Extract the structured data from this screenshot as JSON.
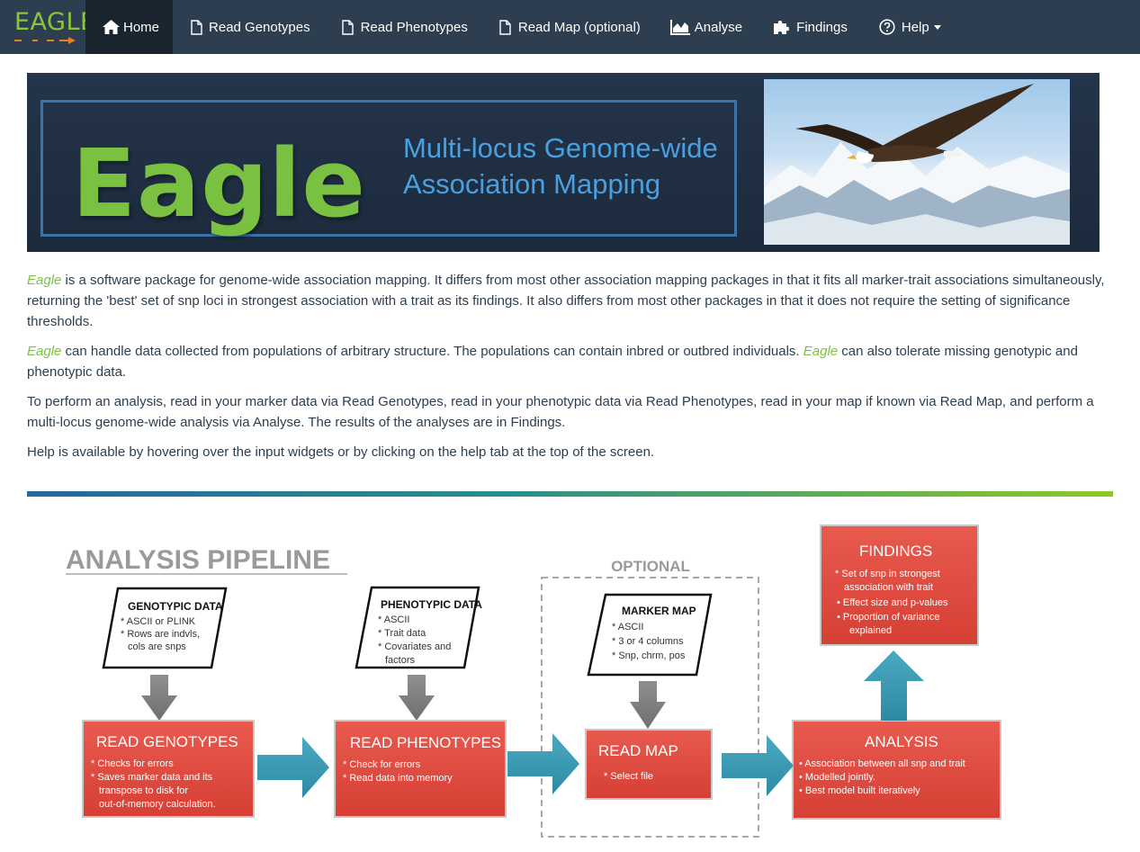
{
  "brand": {
    "name": "EAGLE"
  },
  "nav": {
    "items": [
      {
        "label": "Home",
        "icon": "home-icon",
        "active": true
      },
      {
        "label": "Read Genotypes",
        "icon": "file-icon"
      },
      {
        "label": "Read Phenotypes",
        "icon": "file-icon"
      },
      {
        "label": "Read Map (optional)",
        "icon": "file-icon"
      },
      {
        "label": "Analyse",
        "icon": "area-chart-icon"
      },
      {
        "label": "Findings",
        "icon": "puzzle-icon"
      },
      {
        "label": "Help",
        "icon": "question-circle-icon",
        "dropdown": true
      }
    ]
  },
  "banner": {
    "title": "Eagle",
    "subtitle_line1": "Multi-locus Genome-wide",
    "subtitle_line2": "Association Mapping"
  },
  "intro": {
    "eagle_word": "Eagle",
    "p1_rest": " is a software package for genome-wide association mapping. It differs from most other association mapping packages in that it fits all marker-trait associations simultaneously, returning the 'best' set of snp loci in strongest association with a trait as its findings. It also differs from most other packages in that it does not require the setting of significance thresholds.",
    "p2_part1": " can handle data collected from populations of arbitrary structure. The populations can contain inbred or outbred individuals. ",
    "p2_part2": " can also tolerate missing genotypic and phenotypic data.",
    "p3": "To perform an analysis, read in your marker data via Read Genotypes, read in your phenotypic data via Read Phenotypes, read in your map if known via Read Map, and perform a multi-locus genome-wide analysis via Analyse. The results of the analyses are in Findings.",
    "p4": "Help is available by hovering over the input widgets or by clicking on the help tab at the top of the screen."
  },
  "pipeline": {
    "heading": "ANALYSIS PIPELINE",
    "optional_label": "OPTIONAL",
    "inputs": [
      {
        "title": "GENOTYPIC DATA",
        "lines": [
          "* ASCII or PLINK",
          "* Rows are indvls,",
          "cols are snps"
        ]
      },
      {
        "title": "PHENOTYPIC DATA",
        "lines": [
          "* ASCII",
          "* Trait data",
          "* Covariates and",
          "factors"
        ]
      },
      {
        "title": "MARKER MAP",
        "lines": [
          "* ASCII",
          "* 3 or 4 columns",
          "* Snp, chrm, pos"
        ]
      }
    ],
    "steps": [
      {
        "title": "READ GENOTYPES",
        "lines": [
          "* Checks for errors",
          "* Saves marker data and its",
          "transpose to disk  for",
          "out-of-memory calculation."
        ]
      },
      {
        "title": "READ PHENOTYPES",
        "lines": [
          "* Check for errors",
          "* Read data into memory"
        ]
      },
      {
        "title": "READ MAP",
        "lines": [
          "* Select file"
        ]
      },
      {
        "title": "ANALYSIS",
        "lines": [
          "•  Association between all snp and trait",
          "•  Modelled jointly.",
          "•  Best model built iteratively"
        ]
      }
    ],
    "findings": {
      "title": "FINDINGS",
      "lines": [
        "* Set of snp in strongest",
        "association with trait",
        "•  Effect size and p-values",
        "•  Proportion of variance",
        "explained"
      ]
    }
  },
  "colors": {
    "navbar": "#2c3e50",
    "navbar_active": "#1a242f",
    "accent_green": "#7ac142",
    "step_red": "#e04a3f",
    "arrow_teal": "#3b9ab2"
  }
}
